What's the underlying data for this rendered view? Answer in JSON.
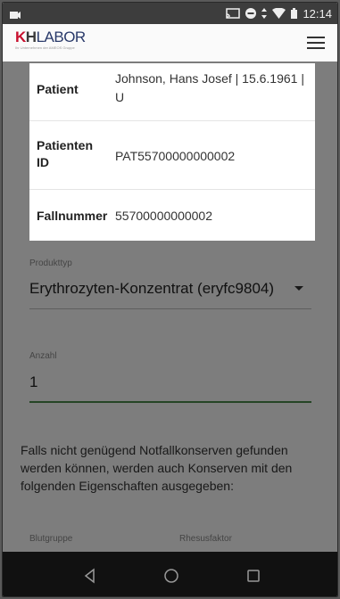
{
  "status_bar": {
    "time": "12:14"
  },
  "app": {
    "logo_k": "K",
    "logo_h": "H",
    "logo_labor": "LABOR",
    "logo_subtitle": "Ihr Unternehmen der AMEOS Gruppe"
  },
  "patient_card": {
    "rows": [
      {
        "key": "Patient",
        "value": "Johnson, Hans Josef | 15.6.1961 | U"
      },
      {
        "key": "Patienten ID",
        "value": "PAT55700000000002"
      },
      {
        "key": "Fallnummer",
        "value": "55700000000002"
      }
    ]
  },
  "form": {
    "product_type_label": "Produkttyp",
    "product_type_value": "Erythrozyten-Konzentrat (eryfc9804)",
    "count_label": "Anzahl",
    "count_value": "1",
    "info_text": "Falls nicht genügend Notfallkonserven gefunden werden können, werden auch Konserven mit den folgenden Eigenschaften ausgegeben:",
    "blood_group_label": "Blutgruppe",
    "rhesus_label": "Rhesusfaktor"
  }
}
